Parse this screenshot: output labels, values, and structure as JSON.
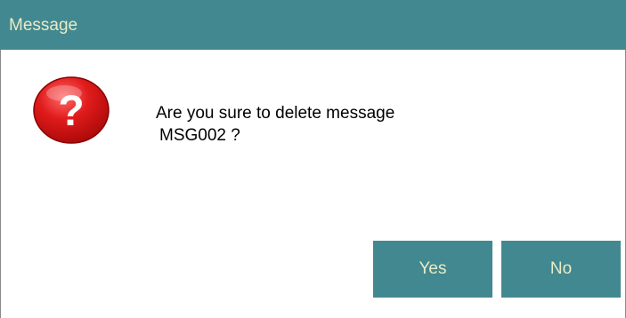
{
  "dialog": {
    "title": "Message",
    "icon": "question-icon",
    "message_line1": "Are you sure to delete message",
    "message_line2": "MSG002 ?",
    "buttons": {
      "yes_label": "Yes",
      "no_label": "No"
    }
  },
  "colors": {
    "title_bar": "#428891",
    "title_text": "#e8ecc4",
    "button_bg": "#428891",
    "button_text": "#e8ecc4",
    "icon_red": "#e01b1b"
  }
}
